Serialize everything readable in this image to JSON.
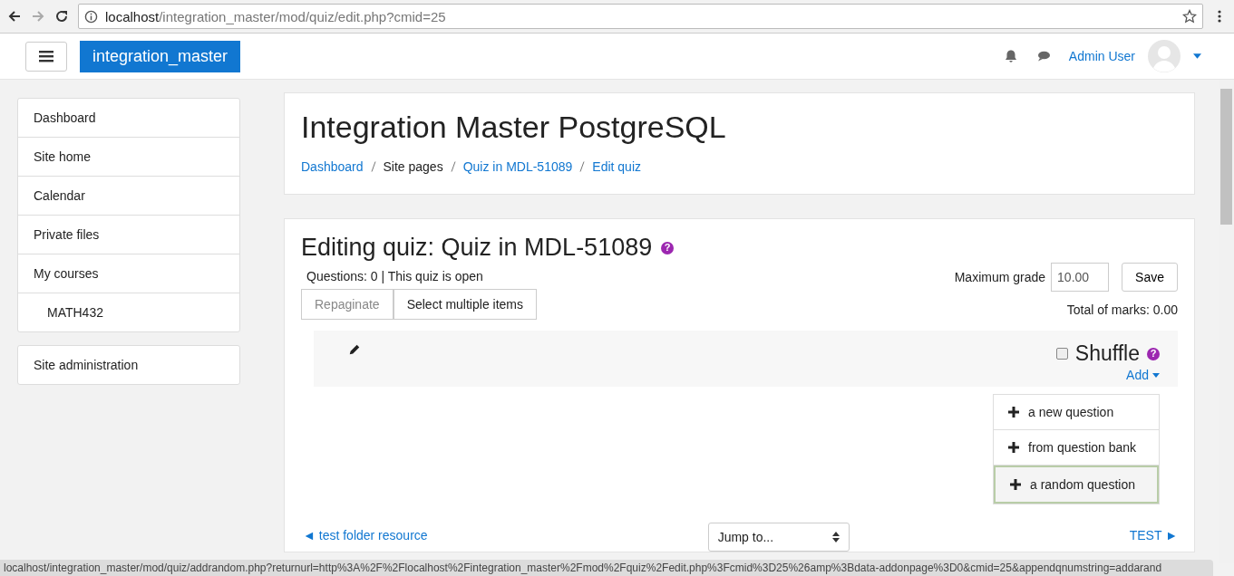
{
  "browser": {
    "url_host": "localhost",
    "url_path": "/integration_master/mod/quiz/edit.php?cmid=25"
  },
  "navbar": {
    "site_name": "integration_master",
    "user_name": "Admin User"
  },
  "sidebar": {
    "items": [
      {
        "label": "Dashboard"
      },
      {
        "label": "Site home"
      },
      {
        "label": "Calendar"
      },
      {
        "label": "Private files"
      },
      {
        "label": "My courses",
        "children": [
          {
            "label": "MATH432"
          }
        ]
      }
    ],
    "admin_item": {
      "label": "Site administration"
    }
  },
  "header": {
    "title": "Integration Master PostgreSQL",
    "breadcrumbs": [
      {
        "label": "Dashboard",
        "link": true
      },
      {
        "label": "Site pages",
        "link": false
      },
      {
        "label": "Quiz in MDL-51089",
        "link": true
      },
      {
        "label": "Edit quiz",
        "link": true
      }
    ]
  },
  "quiz": {
    "title": "Editing quiz: Quiz in MDL-51089",
    "title_help": "?",
    "info": "Questions: 0 | This quiz is open",
    "max_grade_label": "Maximum grade",
    "max_grade": "10.00",
    "save": "Save",
    "total": "Total of marks: 0.00",
    "buttons": [
      {
        "label": "Repaginate",
        "disabled": true
      },
      {
        "label": "Select multiple items",
        "disabled": false
      }
    ],
    "shuffle": {
      "label": "Shuffle",
      "checked": false,
      "help": "?"
    },
    "add": "Add",
    "add_menu": [
      {
        "label": "a new question",
        "selected": false
      },
      {
        "label": "from question bank",
        "selected": false
      },
      {
        "label": "a random question",
        "selected": true
      }
    ],
    "prev_link": "◄ test folder resource",
    "jump": "Jump to...",
    "next_link": "TEST ►"
  },
  "status_bar": "localhost/integration_master/mod/quiz/addrandom.php?returnurl=http%3A%2F%2Flocalhost%2Fintegration_master%2Fmod%2Fquiz%2Fedit.php%3Fcmid%3D25%26amp%3Bdata-addonpage%3D0&cmid=25&appendqnumstring=addarand"
}
